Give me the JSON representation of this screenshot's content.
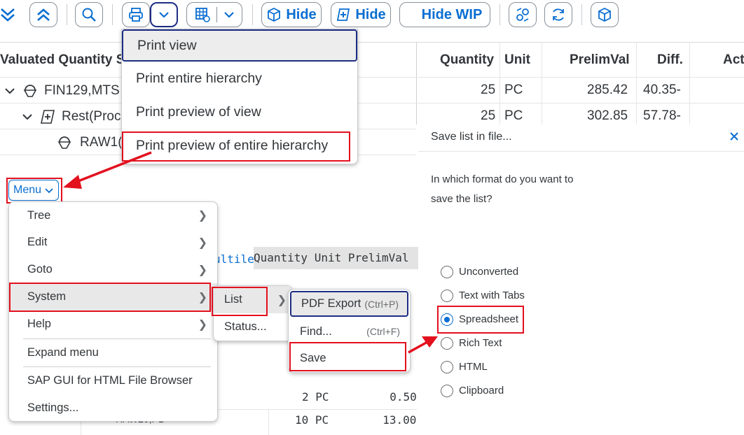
{
  "toolbar": {
    "hide1": "Hide",
    "hide2": "Hide",
    "hide_wip": "Hide WIP"
  },
  "table": {
    "left_header": "Valuated Quantity S",
    "headers": [
      "Quantity",
      "Unit",
      "PrelimVal",
      "Diff.",
      "Act"
    ],
    "tree_rows": [
      "FIN129,MTS",
      "Rest(Proc",
      "RAW1("
    ],
    "rows": [
      {
        "qty": "25",
        "unit": "PC",
        "prelim": "285.42",
        "diff": "40.35-"
      },
      {
        "qty": "25",
        "unit": "PC",
        "prelim": "302.85",
        "diff": "57.78-"
      }
    ]
  },
  "print_menu": {
    "items": [
      "Print view",
      "Print entire hierarchy",
      "Print preview of view",
      "Print preview of entire hierarchy"
    ]
  },
  "menu_button": {
    "label": "Menu"
  },
  "main_menu": {
    "items": [
      "Tree",
      "Edit",
      "Goto",
      "System",
      "Help",
      "Expand menu",
      "SAP GUI for HTML File Browser",
      "Settings..."
    ]
  },
  "system_menu": {
    "items": [
      "List",
      "Status..."
    ]
  },
  "list_menu": {
    "items": [
      {
        "label": "PDF Export",
        "shortcut": "(Ctrl+P)"
      },
      {
        "label": "Find...",
        "shortcut": "(Ctrl+F)"
      },
      {
        "label": "Save",
        "shortcut": ""
      }
    ]
  },
  "background_list": {
    "header_prefix": "ultile",
    "header": "Quantity Unit PrelimVal",
    "row1": "2 PC         0.50",
    "row2": "10 PC        13.00",
    "row2_left": "RAW20,PD"
  },
  "dialog": {
    "title": "Save list in file...",
    "question_line1": "In which format do you want to",
    "question_line2": "save the list?",
    "options": [
      "Unconverted",
      "Text with Tabs",
      "Spreadsheet",
      "Rich Text",
      "HTML",
      "Clipboard"
    ],
    "selected": "Spreadsheet"
  },
  "colors": {
    "accent": "#0a6ed1",
    "highlight": "#e3101e",
    "focus": "#1d2d83"
  }
}
